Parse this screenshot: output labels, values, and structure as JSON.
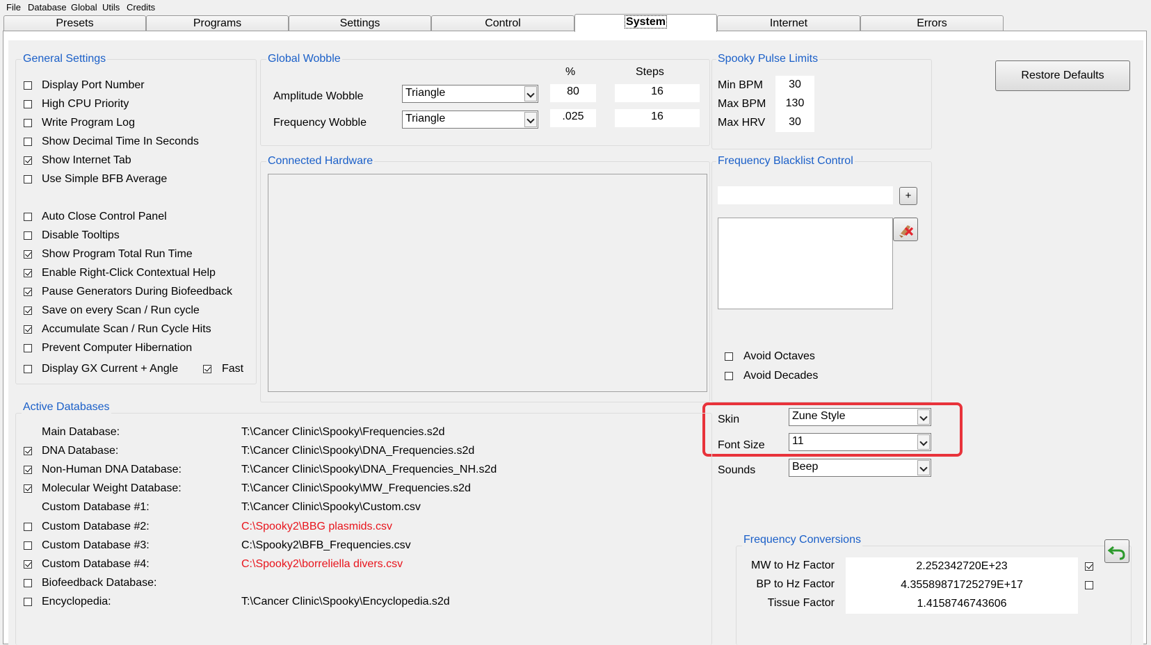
{
  "menu": [
    "File",
    "Database",
    "Global",
    "Utils",
    "Credits"
  ],
  "tabs": [
    "Presets",
    "Programs",
    "Settings",
    "Control",
    "System",
    "Internet",
    "Errors"
  ],
  "active_tab": "System",
  "general_settings": {
    "title": "General Settings",
    "items": [
      {
        "label": "Display Port Number",
        "checked": false
      },
      {
        "label": "High CPU Priority",
        "checked": false
      },
      {
        "label": "Write Program Log",
        "checked": false
      },
      {
        "label": "Show Decimal Time In Seconds",
        "checked": false
      },
      {
        "label": "Show Internet Tab",
        "checked": true
      },
      {
        "label": "Use Simple BFB Average",
        "checked": false
      },
      {
        "label": "Auto Close Control Panel",
        "checked": false
      },
      {
        "label": "Disable Tooltips",
        "checked": false
      },
      {
        "label": "Show Program Total Run Time",
        "checked": true
      },
      {
        "label": "Enable Right-Click Contextual Help",
        "checked": true
      },
      {
        "label": "Pause Generators During Biofeedback",
        "checked": true
      },
      {
        "label": "Save on every Scan / Run cycle",
        "checked": true
      },
      {
        "label": "Accumulate Scan / Run Cycle Hits",
        "checked": true
      },
      {
        "label": "Prevent Computer Hibernation",
        "checked": false
      },
      {
        "label": "Display GX Current + Angle",
        "checked": false
      }
    ],
    "fast": {
      "label": "Fast",
      "checked": true
    }
  },
  "global_wobble": {
    "title": "Global Wobble",
    "col_percent": "%",
    "col_steps": "Steps",
    "rows": [
      {
        "label": "Amplitude Wobble",
        "mode": "Triangle",
        "percent": "80",
        "steps": "16"
      },
      {
        "label": "Frequency Wobble",
        "mode": "Triangle",
        "percent": ".025",
        "steps": "16"
      }
    ]
  },
  "connected_hardware": {
    "title": "Connected Hardware"
  },
  "spooky_pulse": {
    "title": "Spooky Pulse Limits",
    "rows": [
      {
        "label": "Min BPM",
        "value": "30"
      },
      {
        "label": "Max BPM",
        "value": "130"
      },
      {
        "label": "Max HRV",
        "value": "30"
      }
    ]
  },
  "restore_defaults": "Restore Defaults",
  "blacklist": {
    "title": "Frequency Blacklist Control",
    "add": "+",
    "avoid_octaves": {
      "label": "Avoid Octaves",
      "checked": false
    },
    "avoid_decades": {
      "label": "Avoid Decades",
      "checked": false
    }
  },
  "appearance": {
    "skin_label": "Skin",
    "skin_value": "Zune Style",
    "font_label": "Font Size",
    "font_value": "11",
    "sounds_label": "Sounds",
    "sounds_value": "Beep"
  },
  "active_databases": {
    "title": "Active Databases",
    "rows": [
      {
        "label": "Main Database:",
        "path": "T:\\Cancer Clinic\\Spooky\\Frequencies.s2d",
        "checkbox": false,
        "checked": false,
        "red": false
      },
      {
        "label": "DNA Database:",
        "path": "T:\\Cancer Clinic\\Spooky\\DNA_Frequencies.s2d",
        "checkbox": true,
        "checked": true,
        "red": false
      },
      {
        "label": "Non-Human DNA Database:",
        "path": "T:\\Cancer Clinic\\Spooky\\DNA_Frequencies_NH.s2d",
        "checkbox": true,
        "checked": true,
        "red": false
      },
      {
        "label": "Molecular Weight Database:",
        "path": "T:\\Cancer Clinic\\Spooky\\MW_Frequencies.s2d",
        "checkbox": true,
        "checked": true,
        "red": false
      },
      {
        "label": "Custom Database #1:",
        "path": "T:\\Cancer Clinic\\Spooky\\Custom.csv",
        "checkbox": false,
        "checked": false,
        "red": false
      },
      {
        "label": "Custom Database #2:",
        "path": "C:\\Spooky2\\BBG plasmids.csv",
        "checkbox": true,
        "checked": false,
        "red": true
      },
      {
        "label": "Custom Database #3:",
        "path": "C:\\Spooky2\\BFB_Frequencies.csv",
        "checkbox": true,
        "checked": false,
        "red": false
      },
      {
        "label": "Custom Database #4:",
        "path": "C:\\Spooky2\\borreliella divers.csv",
        "checkbox": true,
        "checked": true,
        "red": true
      },
      {
        "label": "Biofeedback Database:",
        "path": "",
        "checkbox": true,
        "checked": false,
        "red": false
      },
      {
        "label": "Encyclopedia:",
        "path": "T:\\Cancer Clinic\\Spooky\\Encyclopedia.s2d",
        "checkbox": true,
        "checked": false,
        "red": false
      }
    ]
  },
  "conversions": {
    "title": "Frequency Conversions",
    "rows": [
      {
        "label": "MW to Hz Factor",
        "value": "2.252342720E+23",
        "checked": true
      },
      {
        "label": "BP to Hz Factor",
        "value": "4.35589871725279E+17",
        "checked": false
      },
      {
        "label": "Tissue Factor",
        "value": "1.4158746743606",
        "checked": null
      }
    ]
  },
  "colors": {
    "accent": "#1a5fc8",
    "highlight": "#e8333b",
    "error_path": "#e8141c"
  }
}
